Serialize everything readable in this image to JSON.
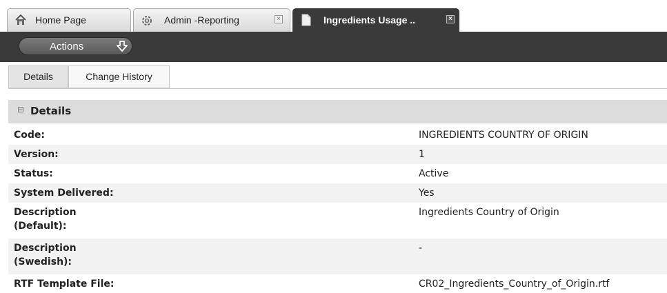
{
  "tabs": [
    {
      "label": "Home Page",
      "icon": "home-icon",
      "closable": false,
      "active": false
    },
    {
      "label": "Admin -Reporting",
      "icon": "gear-icon",
      "closable": true,
      "active": false
    },
    {
      "label": "Ingredients Usage ..",
      "icon": "document-icon",
      "closable": true,
      "active": true
    }
  ],
  "toolbar": {
    "actions_label": "Actions",
    "actions_icon": "arrow-down-icon"
  },
  "subtabs": [
    {
      "label": "Details",
      "active": true
    },
    {
      "label": "Change History",
      "active": false
    }
  ],
  "section": {
    "title": "Details",
    "collapse_glyph": "⊟"
  },
  "details": [
    {
      "label": "Code:",
      "value": "INGREDIENTS COUNTRY OF ORIGIN"
    },
    {
      "label": "Version:",
      "value": "1"
    },
    {
      "label": "Status:",
      "value": "Active"
    },
    {
      "label": "System Delivered:",
      "value": "Yes"
    },
    {
      "label_line1": "Description",
      "label_line2": "(Default):",
      "value": "Ingredients Country of Origin"
    },
    {
      "label_line1": "Description",
      "label_line2": "(Swedish):",
      "value": "-"
    },
    {
      "label": "RTF Template File:",
      "value": "CR02_Ingredients_Country_of_Origin.rtf"
    }
  ],
  "colors": {
    "toolbar_bg": "#3a3a3a",
    "active_tab_bg": "#3a3a3a",
    "section_header_bg": "#dcdcdc",
    "row_alt_bg": "#f2f2f2"
  }
}
